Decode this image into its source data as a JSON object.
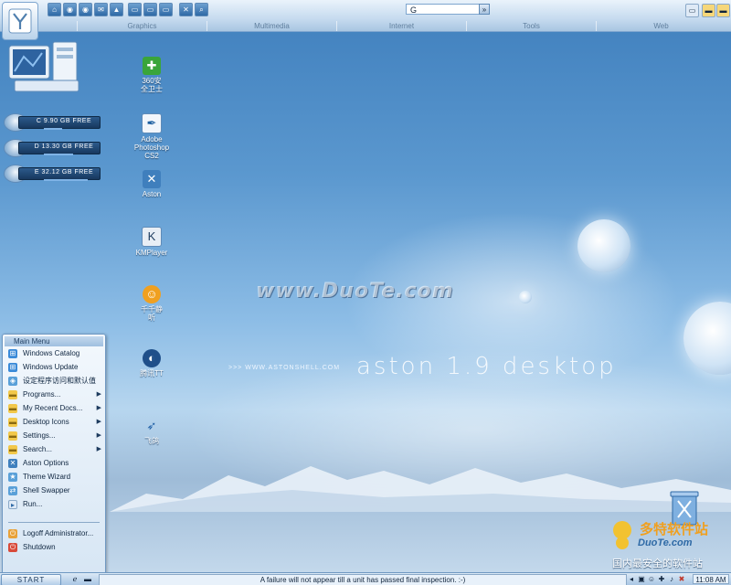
{
  "colors": {
    "accent": "#2f6aa6",
    "menu_bg": "#e3eef8",
    "taskbar": "#b8d0ea"
  },
  "topbar": {
    "menu_tabs": [
      "Graphics",
      "Multimedia",
      "Internet",
      "Tools",
      "Web"
    ],
    "search_value": "G",
    "icons": [
      "home-icon",
      "globe-icon",
      "globe-icon",
      "mail-icon",
      "up-icon",
      "window-icon",
      "window-icon",
      "window-icon",
      "tools-icon",
      "search-icon"
    ]
  },
  "drives": [
    {
      "label": "C 9.90 GB FREE",
      "fill": 0.35
    },
    {
      "label": "D 13.30 GB FREE",
      "fill": 0.55
    },
    {
      "label": "E 32.12 GB FREE",
      "fill": 0.8
    }
  ],
  "desktop_icons": {
    "icon_360": "360安\n全卫士",
    "photoshop": "Adobe\nPhotoshop\nCS2",
    "aston": "Aston",
    "kmplayer": "KMPlayer",
    "qianqian": "千千静\n听",
    "tencent_tt": "腾讯TT",
    "feige": "飞鸽"
  },
  "wallpaper": {
    "site_url": ">>> WWW.ASTONSHELL.COM",
    "title": "aston 1.9 desktop",
    "watermark": "www.DuoTe.com"
  },
  "start_menu": {
    "title": "Main Menu",
    "items": [
      {
        "label": "Windows Catalog",
        "arrow": false
      },
      {
        "label": "Windows Update",
        "arrow": false
      },
      {
        "label": "设定程序访问和默认值",
        "arrow": false
      },
      {
        "label": "Programs...",
        "arrow": true
      },
      {
        "label": "My Recent Docs...",
        "arrow": true
      },
      {
        "label": "Desktop Icons",
        "arrow": true
      },
      {
        "label": "Settings...",
        "arrow": true
      },
      {
        "label": "Search...",
        "arrow": true
      },
      {
        "label": "Aston Options",
        "arrow": false
      },
      {
        "label": "Theme Wizard",
        "arrow": false
      },
      {
        "label": "Shell Swapper",
        "arrow": false
      },
      {
        "label": "Run...",
        "arrow": false
      }
    ],
    "bottom_items": [
      {
        "label": "Logoff Administrator..."
      },
      {
        "label": "Shutdown"
      }
    ]
  },
  "taskbar": {
    "start_label": "START",
    "status_text": "A failure will not appear till a unit has passed final inspection. :-)",
    "clock": "11:08 AM"
  },
  "brand_watermark": {
    "name_cn": "多特软件站",
    "name_en": "DuoTe.com",
    "slogan": "国内最安全的软件站"
  }
}
